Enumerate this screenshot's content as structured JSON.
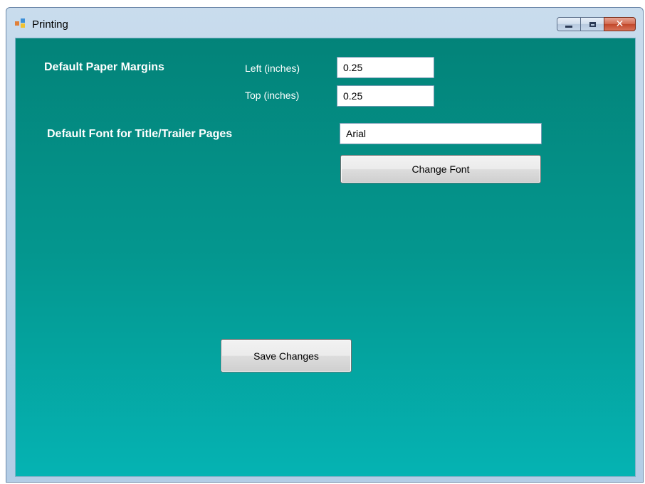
{
  "window": {
    "title": "Printing",
    "icons": {
      "app": "app-icon",
      "minimize": "minimize-icon",
      "maximize": "maximize-icon",
      "close": "close-icon"
    },
    "colors": {
      "client_top": "#038379",
      "client_bottom": "#05b3b3",
      "close_button": "#c2472a"
    }
  },
  "margins": {
    "heading": "Default Paper Margins",
    "left_label": "Left (inches)",
    "left_value": "0.25",
    "top_label": "Top (inches)",
    "top_value": "0.25"
  },
  "font": {
    "heading": "Default Font for Title/Trailer Pages",
    "value": "Arial",
    "change_button": "Change Font"
  },
  "actions": {
    "save_button": "Save Changes"
  }
}
